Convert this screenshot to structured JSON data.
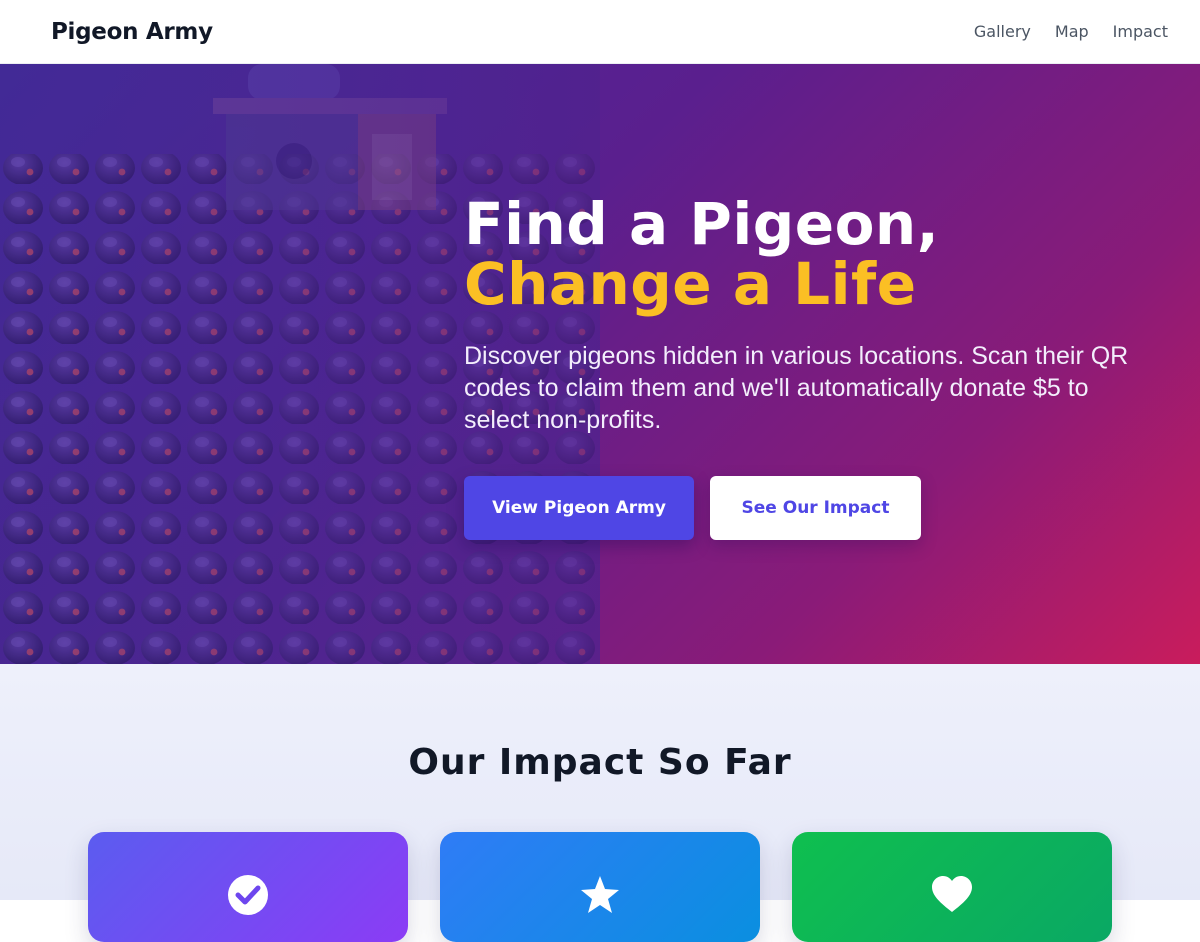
{
  "header": {
    "brand": "Pigeon Army",
    "nav": [
      {
        "label": "Gallery"
      },
      {
        "label": "Map"
      },
      {
        "label": "Impact"
      }
    ]
  },
  "hero": {
    "title_line1": "Find a Pigeon,",
    "title_line2": "Change a Life",
    "subtitle": "Discover pigeons hidden in various locations. Scan their QR codes to claim them and we'll automatically donate $5 to select non-profits.",
    "primary_button": "View Pigeon Army",
    "secondary_button": "See Our Impact"
  },
  "impact": {
    "title": "Our Impact So Far",
    "cards": [
      {
        "icon": "check-circle-icon"
      },
      {
        "icon": "star-icon"
      },
      {
        "icon": "heart-icon"
      }
    ]
  },
  "colors": {
    "accent": "#4f46e5",
    "highlight": "#fbbf24"
  }
}
